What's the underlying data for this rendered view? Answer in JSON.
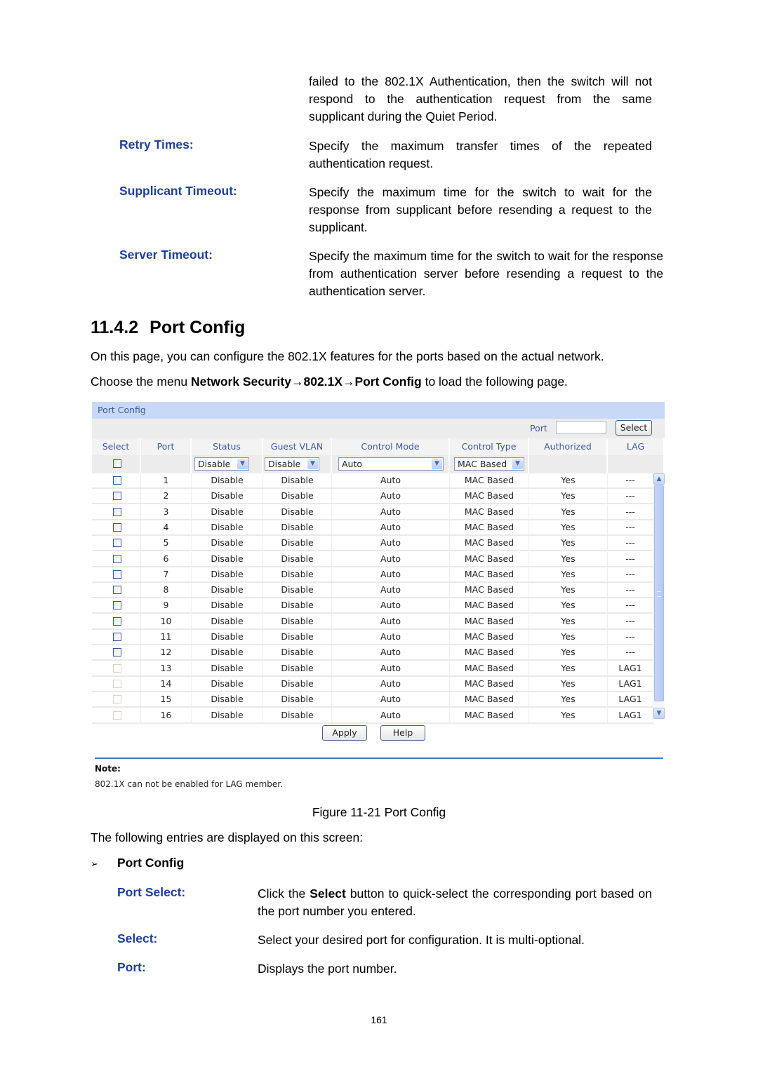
{
  "continued": {
    "text": "failed to the 802.1X Authentication, then the switch will not respond to the authentication request from the same supplicant during the Quiet Period."
  },
  "params_top": [
    {
      "term": "Retry Times:",
      "desc": "Specify the maximum transfer times of the repeated authentication request."
    },
    {
      "term": "Supplicant Timeout:",
      "desc": "Specify the maximum time for the switch to wait for the response from supplicant before resending a request to the supplicant."
    },
    {
      "term": "Server Timeout:",
      "desc": "Specify the maximum time for the switch to wait for the response from authentication server before resending a request to the authentication server."
    }
  ],
  "section": {
    "number": "11.4.2",
    "title": "Port Config",
    "intro": "On this page, you can configure the 802.1X features for the ports based on the actual network.",
    "menu_prefix": "Choose the menu ",
    "menu_path": "Network Security→802.1X→Port Config",
    "menu_suffix": " to load the following page."
  },
  "ui": {
    "panel_title": "Port Config",
    "port_label": "Port",
    "port_input_value": "",
    "select_button": "Select",
    "columns": [
      "Select",
      "Port",
      "Status",
      "Guest VLAN",
      "Control Mode",
      "Control Type",
      "Authorized",
      "LAG"
    ],
    "filters": {
      "status": "Disable",
      "guest_vlan": "Disable",
      "control_mode": "Auto",
      "control_type": "MAC Based"
    },
    "rows": [
      {
        "port": "1",
        "status": "Disable",
        "guest_vlan": "Disable",
        "control_mode": "Auto",
        "control_type": "MAC Based",
        "authorized": "Yes",
        "lag": "---",
        "selectable": true
      },
      {
        "port": "2",
        "status": "Disable",
        "guest_vlan": "Disable",
        "control_mode": "Auto",
        "control_type": "MAC Based",
        "authorized": "Yes",
        "lag": "---",
        "selectable": true
      },
      {
        "port": "3",
        "status": "Disable",
        "guest_vlan": "Disable",
        "control_mode": "Auto",
        "control_type": "MAC Based",
        "authorized": "Yes",
        "lag": "---",
        "selectable": true
      },
      {
        "port": "4",
        "status": "Disable",
        "guest_vlan": "Disable",
        "control_mode": "Auto",
        "control_type": "MAC Based",
        "authorized": "Yes",
        "lag": "---",
        "selectable": true
      },
      {
        "port": "5",
        "status": "Disable",
        "guest_vlan": "Disable",
        "control_mode": "Auto",
        "control_type": "MAC Based",
        "authorized": "Yes",
        "lag": "---",
        "selectable": true
      },
      {
        "port": "6",
        "status": "Disable",
        "guest_vlan": "Disable",
        "control_mode": "Auto",
        "control_type": "MAC Based",
        "authorized": "Yes",
        "lag": "---",
        "selectable": true
      },
      {
        "port": "7",
        "status": "Disable",
        "guest_vlan": "Disable",
        "control_mode": "Auto",
        "control_type": "MAC Based",
        "authorized": "Yes",
        "lag": "---",
        "selectable": true
      },
      {
        "port": "8",
        "status": "Disable",
        "guest_vlan": "Disable",
        "control_mode": "Auto",
        "control_type": "MAC Based",
        "authorized": "Yes",
        "lag": "---",
        "selectable": true
      },
      {
        "port": "9",
        "status": "Disable",
        "guest_vlan": "Disable",
        "control_mode": "Auto",
        "control_type": "MAC Based",
        "authorized": "Yes",
        "lag": "---",
        "selectable": true
      },
      {
        "port": "10",
        "status": "Disable",
        "guest_vlan": "Disable",
        "control_mode": "Auto",
        "control_type": "MAC Based",
        "authorized": "Yes",
        "lag": "---",
        "selectable": true
      },
      {
        "port": "11",
        "status": "Disable",
        "guest_vlan": "Disable",
        "control_mode": "Auto",
        "control_type": "MAC Based",
        "authorized": "Yes",
        "lag": "---",
        "selectable": true
      },
      {
        "port": "12",
        "status": "Disable",
        "guest_vlan": "Disable",
        "control_mode": "Auto",
        "control_type": "MAC Based",
        "authorized": "Yes",
        "lag": "---",
        "selectable": true
      },
      {
        "port": "13",
        "status": "Disable",
        "guest_vlan": "Disable",
        "control_mode": "Auto",
        "control_type": "MAC Based",
        "authorized": "Yes",
        "lag": "LAG1",
        "selectable": false
      },
      {
        "port": "14",
        "status": "Disable",
        "guest_vlan": "Disable",
        "control_mode": "Auto",
        "control_type": "MAC Based",
        "authorized": "Yes",
        "lag": "LAG1",
        "selectable": false
      },
      {
        "port": "15",
        "status": "Disable",
        "guest_vlan": "Disable",
        "control_mode": "Auto",
        "control_type": "MAC Based",
        "authorized": "Yes",
        "lag": "LAG1",
        "selectable": false
      },
      {
        "port": "16",
        "status": "Disable",
        "guest_vlan": "Disable",
        "control_mode": "Auto",
        "control_type": "MAC Based",
        "authorized": "Yes",
        "lag": "LAG1",
        "selectable": false
      }
    ],
    "apply_button": "Apply",
    "help_button": "Help",
    "note_title": "Note:",
    "note_text": "802.1X can not be enabled for LAG member."
  },
  "figure_caption": "Figure 11-21 Port Config",
  "entries_intro": "The following entries are displayed on this screen:",
  "subsection": {
    "bullet": "➢",
    "title": "Port Config"
  },
  "params_bottom": [
    {
      "term": "Port Select:",
      "desc_pre": "Click the ",
      "desc_bold": "Select",
      "desc_post": " button to quick-select the corresponding port based on the port number you entered."
    },
    {
      "term": "Select:",
      "desc": "Select your desired port for configuration. It is multi-optional."
    },
    {
      "term": "Port:",
      "desc": "Displays the port number."
    }
  ],
  "page_number": "161",
  "colors": {
    "term_blue": "#1f3f99",
    "ui_header_blue": "#c7d9f7",
    "ui_label_blue": "#3a5a9a",
    "note_rule": "#3c7ac4"
  }
}
